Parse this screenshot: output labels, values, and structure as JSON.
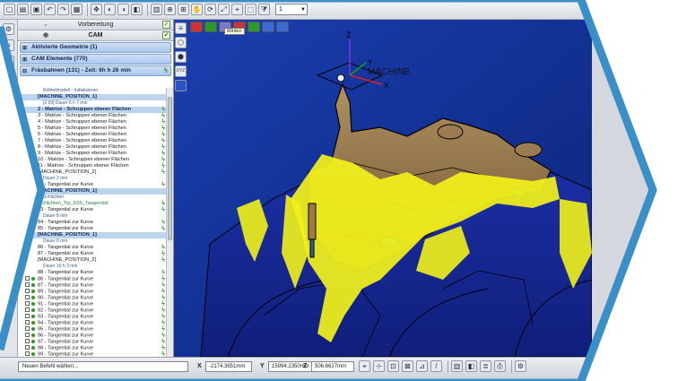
{
  "toolbar": {
    "layer_value": "1",
    "icons": [
      "new-icon",
      "open-icon",
      "save-icon",
      "undo-icon",
      "redo-icon",
      "grid-icon",
      "snap-icon",
      "render-icon",
      "zoom-icon",
      "pan-icon"
    ]
  },
  "panel": {
    "tab_top": "Vorbereitung",
    "tab_cam": "CAM",
    "sections": [
      "Aktivierte Geometrie (1)",
      "CAM Elemente (770)",
      "Fräsbahnen (131) - Zeit: 6h h 26 min"
    ],
    "tree": [
      {
        "text": "Rohteilmodell - Initialisieren",
        "type": "info",
        "bolt": false
      },
      {
        "text": "[MACHINE_POSITION_1]",
        "type": "hl",
        "bolt": false
      },
      {
        "text": "[2 59] Dauer 6 h 7 min",
        "type": "info",
        "bolt": false
      },
      {
        "text": "2 - Matrize - Schruppen ebener Flächen",
        "type": "hl",
        "bolt": true
      },
      {
        "text": "3 - Matrize - Schruppen ebener Flächen",
        "type": "normal",
        "bolt": true
      },
      {
        "text": "4 - Matrize - Schruppen ebener Flächen",
        "type": "normal",
        "bolt": true
      },
      {
        "text": "5 - Matrize - Schruppen ebener Flächen",
        "type": "normal",
        "bolt": true
      },
      {
        "text": "6 - Matrize - Schruppen ebener Flächen",
        "type": "normal",
        "bolt": true
      },
      {
        "text": "7 - Matrize - Schruppen ebener Flächen",
        "type": "normal",
        "bolt": true
      },
      {
        "text": "8 - Matrize - Schruppen ebener Flächen",
        "type": "normal",
        "bolt": true
      },
      {
        "text": "9 - Matrize - Schruppen ebener Flächen",
        "type": "normal",
        "bolt": true
      },
      {
        "text": "10 - Matrize - Schruppen ebener Flächen",
        "type": "normal",
        "bolt": true
      },
      {
        "text": "11 - Matrize - Schruppen ebener Flächen",
        "type": "normal",
        "bolt": true
      },
      {
        "text": "[MACHINE_POSITION_2]",
        "type": "normal",
        "bolt": true
      },
      {
        "text": "Dauer 2 min",
        "type": "info",
        "bolt": false
      },
      {
        "text": "12 - Tangential zur Kurve",
        "type": "normal",
        "bolt": true
      },
      {
        "text": "[MACHINE_POSITION_1]",
        "type": "hl",
        "bolt": false
      },
      {
        "text": "Schlichten",
        "type": "info",
        "bolt": false
      },
      {
        "text": "Schlichten_Tip_D25_Tangential",
        "type": "green",
        "bolt": true
      },
      {
        "text": "13 - Tangential zur Kurve",
        "type": "normal",
        "bolt": true
      },
      {
        "text": "Dauer 8 min",
        "type": "info",
        "bolt": false
      },
      {
        "text": "84 - Tangential zur Kurve",
        "type": "normal",
        "bolt": true
      },
      {
        "text": "85 - Tangential zur Kurve",
        "type": "normal",
        "bolt": true
      },
      {
        "text": "[MACHINE_POSITION_1]",
        "type": "hl",
        "bolt": false
      },
      {
        "text": "Dauer 8 min",
        "type": "info",
        "bolt": false
      },
      {
        "text": "86 - Tangential zur Kurve",
        "type": "normal",
        "bolt": true
      },
      {
        "text": "87 - Tangential zur Kurve",
        "type": "normal",
        "bolt": true
      },
      {
        "text": "[MACHINE_POSITION_2]",
        "type": "normal",
        "bolt": true
      },
      {
        "text": "Dauer 10 h 3 min",
        "type": "info",
        "bolt": false
      },
      {
        "text": "88 - Tangential zur Kurve",
        "type": "normal",
        "bolt": true
      },
      {
        "text": "86 - Tangential zur Kurve",
        "type": "check",
        "bolt": true
      },
      {
        "text": "87 - Tangential zur Kurve",
        "type": "check",
        "bolt": true
      },
      {
        "text": "89 - Tangential zur Kurve",
        "type": "check",
        "bolt": true
      },
      {
        "text": "90 - Tangential zur Kurve",
        "type": "check",
        "bolt": true
      },
      {
        "text": "91 - Tangential zur Kurve",
        "type": "check",
        "bolt": true
      },
      {
        "text": "92 - Tangential zur Kurve",
        "type": "check",
        "bolt": true
      },
      {
        "text": "93 - Tangential zur Kurve",
        "type": "check",
        "bolt": true
      },
      {
        "text": "94 - Tangential zur Kurve",
        "type": "check",
        "bolt": true
      },
      {
        "text": "95 - Tangential zur Kurve",
        "type": "check",
        "bolt": true
      },
      {
        "text": "96 - Tangential zur Kurve",
        "type": "check",
        "bolt": true
      },
      {
        "text": "97 - Tangential zur Kurve",
        "type": "check",
        "bolt": true
      },
      {
        "text": "98 - Tangential zur Kurve",
        "type": "check",
        "bolt": true
      },
      {
        "text": "99 - Tangential zur Kurve",
        "type": "check",
        "bolt": true
      }
    ]
  },
  "viewport": {
    "tooltip": "Minten",
    "machine_label": "MACHINE",
    "axis_z": "Z",
    "axis_y": "Y",
    "axis_x": "X",
    "mini_axis_label": "XYZ",
    "colors": {
      "background": "#0f2a8a",
      "part_bronze": "#8a6d45",
      "toolpath_yellow": "#f2f21a",
      "edge": "#000000",
      "frame_blue": "#3b8fc7"
    }
  },
  "status": {
    "command_placeholder": "Neuen Befehl wählen...",
    "x_label": "X",
    "x_value": "-2174.3651mm",
    "y_label": "Y",
    "y_value": "15994.2350mm",
    "z_label": "Z",
    "z_value": "506.6627mm"
  }
}
